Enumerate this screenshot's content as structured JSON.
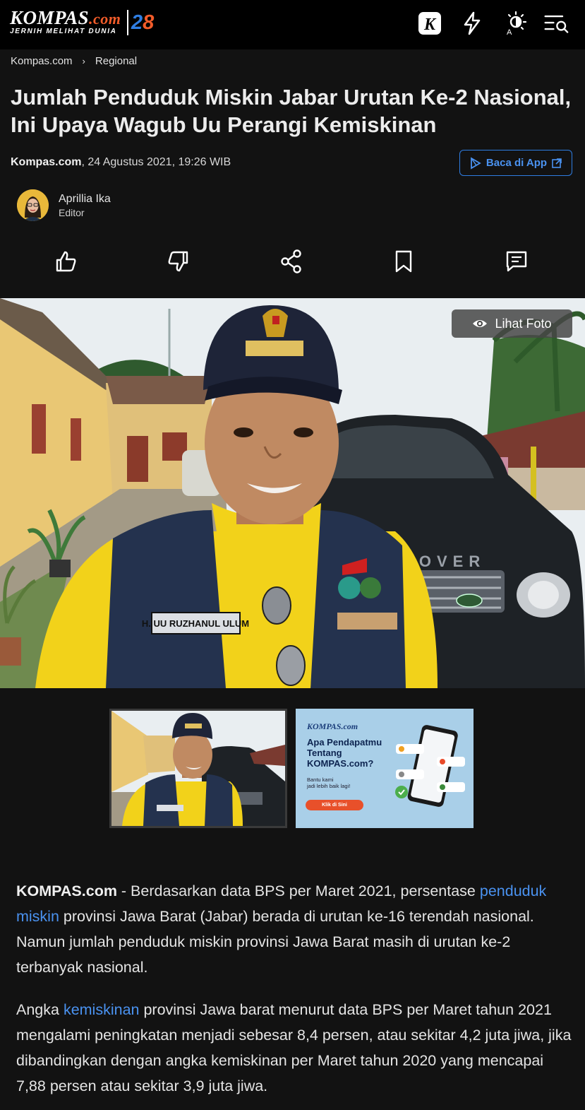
{
  "header": {
    "logo_text": "KOMPAS",
    "logo_dotcom": ".com",
    "logo_tagline": "JERNIH MELIHAT DUNIA",
    "anniversary_tens": "2",
    "anniversary_ones": "8",
    "icons": [
      "kompas-k-icon",
      "lightning-icon",
      "theme-toggle-icon",
      "menu-search-icon"
    ]
  },
  "breadcrumb": {
    "home": "Kompas.com",
    "separator": "›",
    "section": "Regional"
  },
  "article": {
    "title": "Jumlah Penduduk Miskin Jabar Urutan Ke-2 Nasional, Ini Upaya Wagub Uu Perangi Kemiskinan",
    "source": "Kompas.com",
    "date": ", 24 Agustus 2021, 19:26 WIB",
    "app_button_label": "Baca di App",
    "author_name": "Aprillia Ika",
    "author_role": "Editor",
    "photo_button_label": "Lihat Foto",
    "vest_name_tag": "H. UU RUZHANUL ULUM",
    "car_badge": "ROVER"
  },
  "actions": [
    "like-icon",
    "dislike-icon",
    "share-icon",
    "bookmark-icon",
    "comment-icon"
  ],
  "ad": {
    "brand": "KOMPAS.com",
    "headline_1": "Apa Pendapatmu",
    "headline_2": "Tentang",
    "headline_3": "KOMPAS.com?",
    "sub_1": "Bantu kami",
    "sub_2": "jadi lebih baik lagi!",
    "cta": "Klik di Sini"
  },
  "body": {
    "p1_lead": "KOMPAS.com",
    "p1_a": " - Berdasarkan data BPS per Maret 2021, persentase ",
    "p1_link": "penduduk miskin",
    "p1_b": " provinsi Jawa Barat (Jabar) berada di urutan ke-16 terendah nasional. Namun jumlah penduduk miskin provinsi Jawa Barat masih di urutan ke-2 terbanyak nasional.",
    "p2_a": "Angka ",
    "p2_link": "kemiskinan",
    "p2_b": " provinsi Jawa barat menurut data BPS per Maret tahun 2021 mengalami peningkatan menjadi sebesar 8,4 persen, atau sekitar 4,2 juta jiwa, jika dibandingkan dengan angka kemiskinan per Maret tahun 2020 yang mencapai 7,88 persen atau sekitar 3,9 juta jiwa."
  },
  "colors": {
    "background": "#121212",
    "topbar": "#000000",
    "accent_blue": "#2f7de1",
    "accent_orange": "#f25c2a"
  }
}
